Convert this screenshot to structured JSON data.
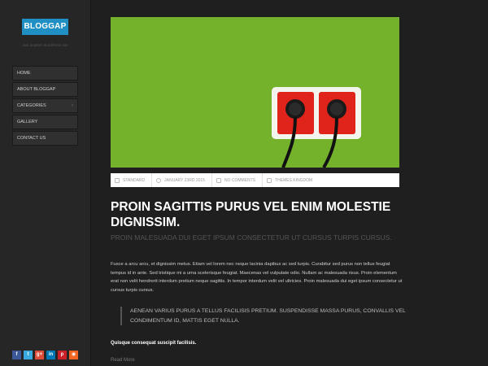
{
  "site": {
    "logo_text": "BLOGGAP",
    "tagline": "Just another WordPress site"
  },
  "nav": {
    "items": [
      {
        "label": "HOME"
      },
      {
        "label": "ABOUT BLOGGAP"
      },
      {
        "label": "CATEGORIES",
        "has_submenu": true
      },
      {
        "label": "GALLERY"
      },
      {
        "label": "CONTACT US"
      }
    ],
    "submenu_arrow": "›"
  },
  "social": [
    {
      "icon": "facebook-icon",
      "glyph": "f",
      "color": "#3b5998"
    },
    {
      "icon": "twitter-icon",
      "glyph": "t",
      "color": "#39a9e0"
    },
    {
      "icon": "google-plus-icon",
      "glyph": "g+",
      "color": "#dd4b39"
    },
    {
      "icon": "linkedin-icon",
      "glyph": "in",
      "color": "#0077b5"
    },
    {
      "icon": "pinterest-icon",
      "glyph": "p",
      "color": "#cb2027"
    },
    {
      "icon": "rss-icon",
      "glyph": "◉",
      "color": "#f26522"
    }
  ],
  "post": {
    "meta": {
      "format": "STANDARD",
      "date": "JANUARY 23RD 2015",
      "comments": "NO COMMENTS",
      "author": "THEMES KINGDOM"
    },
    "title": "PROIN SAGITTIS PURUS VEL ENIM MOLESTIE DIGNISSIM.",
    "subtitle": "PROIN MALESUADA DUI EGET IPSUM CONSECTETUR UT CURSUS TURPIS CURSUS.",
    "body": "Fusce a arcu arcu, et dignissim metus. Etiam vel lorem nec neque lacinia dapibus ac sed turpis. Curabitur sed purus non tellus feugiat tempus id in ante. Sed tristique mi a urna scelerisque feugiat. Maecenas vel vulputate odio. Nullam ac malesuada risus. Proin elementum erat non velit hendrerit interdum pretium neque sagittis. In tempor interdum velit vel ultricies. Proin malesuada dui eget ipsum consectetur ut cursus turpis cursus.",
    "quote": "AENEAN VARIUS PURUS A TELLUS FACILISIS PRETIUM. SUSPENDISSE MASSA PURUS, CONVALLIS VEL CONDIMENTUM ID, MATTIS EGET NULLA.",
    "bold_line": "Quisque consequat suscipit facilisis.",
    "read_more": "Read More"
  },
  "colors": {
    "accent": "#1f8fc4",
    "image_bg": "#73b22a",
    "socket_red": "#e0241c"
  }
}
